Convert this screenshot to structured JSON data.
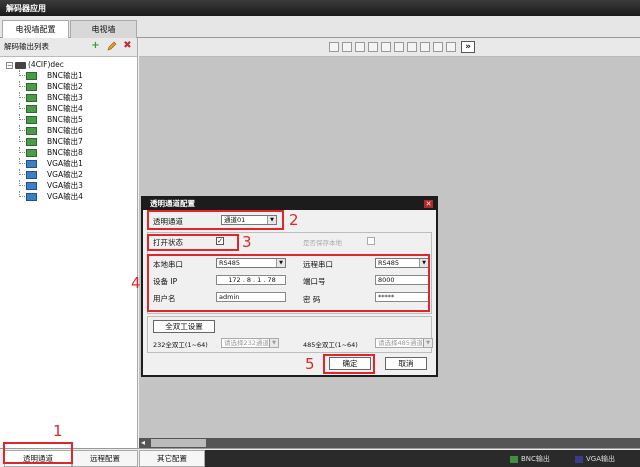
{
  "app": {
    "title": "解码器应用"
  },
  "tabs": [
    {
      "label": "电视墙配置",
      "active": true
    },
    {
      "label": "电视墙",
      "active": false
    }
  ],
  "left_panel": {
    "title": "解码输出列表",
    "icons": [
      "add-icon",
      "edit-icon",
      "delete-icon"
    ],
    "tree": {
      "root": "(4CIF)dec",
      "children": [
        {
          "label": "BNC输出1",
          "type": "bnc"
        },
        {
          "label": "BNC输出2",
          "type": "bnc"
        },
        {
          "label": "BNC输出3",
          "type": "bnc"
        },
        {
          "label": "BNC输出4",
          "type": "bnc"
        },
        {
          "label": "BNC输出5",
          "type": "bnc"
        },
        {
          "label": "BNC输出6",
          "type": "bnc"
        },
        {
          "label": "BNC输出7",
          "type": "bnc"
        },
        {
          "label": "BNC输出8",
          "type": "bnc"
        },
        {
          "label": "VGA输出1",
          "type": "vga"
        },
        {
          "label": "VGA输出2",
          "type": "vga"
        },
        {
          "label": "VGA输出3",
          "type": "vga"
        },
        {
          "label": "VGA输出4",
          "type": "vga"
        }
      ]
    }
  },
  "toolbar": {
    "layout_icon_count": 10,
    "more_label": "»"
  },
  "bottom_tabs": [
    {
      "label": "透明通道",
      "active": true
    },
    {
      "label": "远程配置",
      "active": false
    },
    {
      "label": "其它配置",
      "active": false
    }
  ],
  "legend": [
    {
      "label": "BNC输出",
      "color": "#3f8f3f"
    },
    {
      "label": "VGA输出",
      "color": "#3a3a8a"
    }
  ],
  "dialog": {
    "title": "透明通道配置",
    "channel_label": "透明通道",
    "channel_value": "通道01",
    "open_state_label": "打开状态",
    "open_state_checked": "✓",
    "save_label": "是否保存本地",
    "local_serial_label": "本地串口",
    "local_serial_value": "RS485",
    "remote_serial_label": "远程串口",
    "remote_serial_value": "RS485",
    "device_ip_label": "设备 IP",
    "device_ip_value": "172 . 8 . 1 . 78",
    "port_label": "端口号",
    "port_value": "8000",
    "username_label": "用户名",
    "username_value": "admin",
    "password_label": "密  码",
    "password_value": "*****",
    "duplex_button": "全双工设置",
    "duplex232_label": "232全双工(1~64)",
    "duplex232_value": "请选择232通道",
    "duplex485_label": "485全双工(1~64)",
    "duplex485_value": "请选择485通道",
    "ok_label": "确定",
    "cancel_label": "取消"
  },
  "annotations": {
    "n1": "1",
    "n2": "2",
    "n3": "3",
    "n4": "4",
    "n5": "5"
  }
}
